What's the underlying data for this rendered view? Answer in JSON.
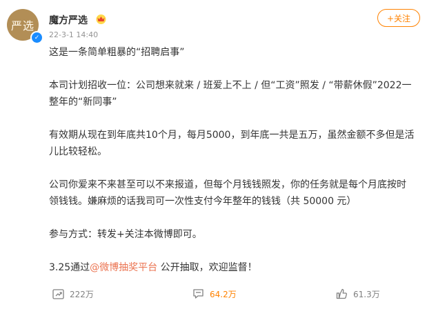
{
  "author": {
    "avatar_text": "严选",
    "name": "魔方严选",
    "timestamp": "22-3-1 14:40",
    "verified_mark": "✓",
    "crown_icon": "crown-icon"
  },
  "follow_button": "+关注",
  "post": {
    "p1": "这是一条简单粗暴的“招聘启事”",
    "p2": "本司计划招收一位：公司想来就来 / 班爱上不上 / 但“工资”照发 / “带薪休假”2022一整年的“新同事”",
    "p3": "有效期从现在到年底共10个月，每月5000，到年底一共是五万，虽然金额不多但是活儿比较轻松。",
    "p4": "公司你爱来不来甚至可以不来报道，但每个月钱钱照发，你的任务就是每个月底按时领钱钱。嫌麻烦的话我司可一次性支付今年整年的钱钱（共 50000 元）",
    "p5": "参与方式：转发+关注本微博即可。",
    "p6_prefix": "3.25通过",
    "p6_link": "@微博抽奖平台",
    "p6_suffix": " 公开抽取，欢迎监督！"
  },
  "actions": {
    "repost_count": "222万",
    "comment_count": "64.2万",
    "like_count": "61.3万"
  },
  "colors": {
    "accent": "#ff8200",
    "link": "#eb7350",
    "avatar_bg": "#b28e56",
    "verified": "#1a8cff"
  }
}
